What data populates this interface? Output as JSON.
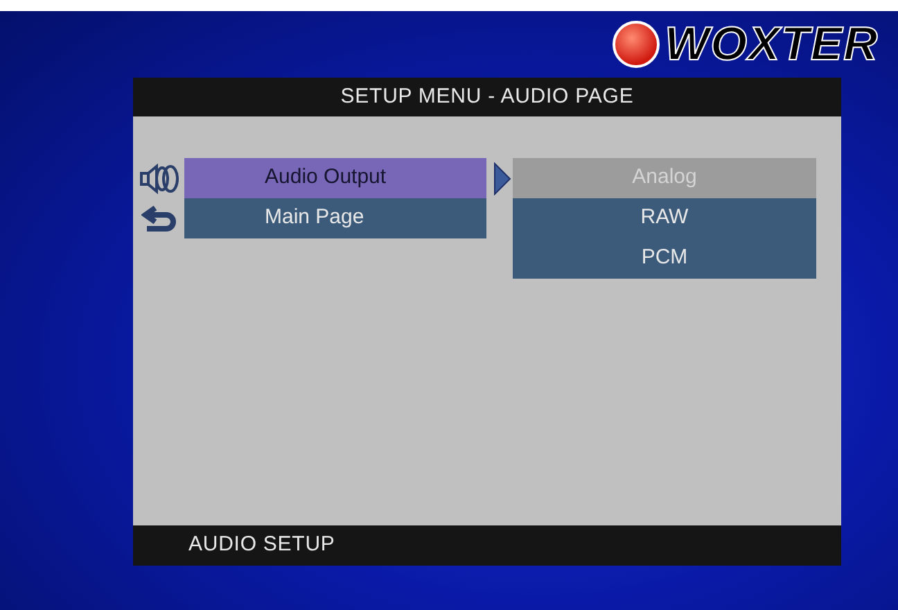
{
  "logo": {
    "text": "WOXTER"
  },
  "dialog": {
    "title": "SETUP MENU - AUDIO PAGE",
    "menu_items": [
      {
        "label": "Audio Output",
        "kind": "speaker",
        "selected": true
      },
      {
        "label": "Main Page",
        "kind": "return",
        "selected": false
      }
    ],
    "options": [
      {
        "label": "Analog",
        "selected": true
      },
      {
        "label": "RAW",
        "selected": false
      },
      {
        "label": "PCM",
        "selected": false
      }
    ],
    "footer": "AUDIO SETUP"
  }
}
